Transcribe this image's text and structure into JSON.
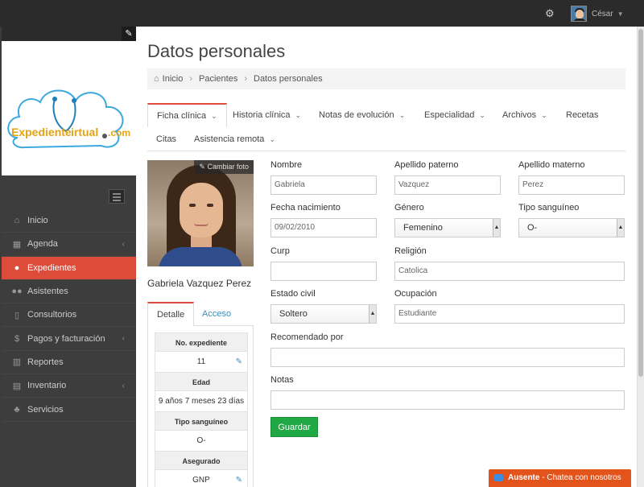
{
  "topbar": {
    "user_name": "César"
  },
  "logo": {
    "text_part1": "Expediente",
    "text_part2": "irtual",
    "text_part3": ".com"
  },
  "sidebar": {
    "items": [
      {
        "label": "Inicio",
        "icon": "home-icon"
      },
      {
        "label": "Agenda",
        "icon": "calendar-icon",
        "has_submenu": true
      },
      {
        "label": "Expedientes",
        "icon": "user-icon",
        "active": true
      },
      {
        "label": "Asistentes",
        "icon": "users-icon"
      },
      {
        "label": "Consultorios",
        "icon": "clipboard-icon"
      },
      {
        "label": "Pagos y facturación",
        "icon": "dollar-icon",
        "has_submenu": true
      },
      {
        "label": "Reportes",
        "icon": "chart-icon"
      },
      {
        "label": "Inventario",
        "icon": "inventory-icon",
        "has_submenu": true
      },
      {
        "label": "Servicios",
        "icon": "services-icon"
      }
    ]
  },
  "page": {
    "title": "Datos personales"
  },
  "breadcrumb": {
    "home": "Inicio",
    "parent": "Pacientes",
    "current": "Datos personales"
  },
  "tabs": [
    {
      "label": "Ficha clínica",
      "active": true,
      "dropdown": true
    },
    {
      "label": "Historia clínica",
      "dropdown": true
    },
    {
      "label": "Notas de evolución",
      "dropdown": true
    },
    {
      "label": "Especialidad",
      "dropdown": true
    },
    {
      "label": "Archivos",
      "dropdown": true
    },
    {
      "label": "Recetas"
    },
    {
      "label": "Citas"
    },
    {
      "label": "Asistencia remota",
      "dropdown": true
    }
  ],
  "patient": {
    "change_photo": "Cambiar foto",
    "name": "Gabriela Vazquez Perez",
    "tabs": {
      "detail": "Detalle",
      "access": "Acceso"
    },
    "info": [
      {
        "label": "No. expediente",
        "value": "11",
        "editable": true
      },
      {
        "label": "Edad",
        "value": "9 años 7 meses 23 días"
      },
      {
        "label": "Tipo sanguíneo",
        "value": "O-"
      },
      {
        "label": "Asegurado",
        "value": "GNP",
        "editable": true
      }
    ]
  },
  "form": {
    "nombre": {
      "label": "Nombre",
      "value": "Gabriela"
    },
    "apellido_paterno": {
      "label": "Apellido paterno",
      "value": "Vazquez"
    },
    "apellido_materno": {
      "label": "Apellido materno",
      "value": "Perez"
    },
    "fecha_nacimiento": {
      "label": "Fecha nacimiento",
      "value": "09/02/2010"
    },
    "genero": {
      "label": "Género",
      "value": "Femenino"
    },
    "tipo_sanguineo": {
      "label": "Tipo sanguíneo",
      "value": "O-"
    },
    "curp": {
      "label": "Curp",
      "value": ""
    },
    "religion": {
      "label": "Religión",
      "value": "Catolica"
    },
    "estado_civil": {
      "label": "Estado civil",
      "value": "Soltero"
    },
    "ocupacion": {
      "label": "Ocupación",
      "value": "Estudiante"
    },
    "recomendado_por": {
      "label": "Recomendado por",
      "value": ""
    },
    "notas": {
      "label": "Notas",
      "value": ""
    },
    "save_label": "Guardar"
  },
  "chat": {
    "status": "Ausente",
    "separator": " - ",
    "text": "Chatea con nosotros"
  },
  "colors": {
    "accent": "#dd4b39",
    "sidebar": "#3d3d3d",
    "save": "#20a844",
    "chat": "#e2541b",
    "link": "#3c8dbc"
  }
}
